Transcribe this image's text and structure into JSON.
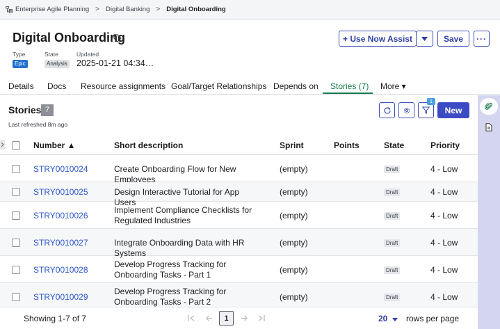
{
  "breadcrumb": {
    "items": [
      "Enterprise Agile Planning",
      "Digital Banking",
      "Digital Onboarding"
    ],
    "separator": ">"
  },
  "header": {
    "title": "Digital Onboarding",
    "type_label": "Type",
    "type_value": "Epic",
    "state_label": "State",
    "state_value": "Analysis",
    "updated_label": "Updated",
    "updated_value": "2025-01-21 04:34…",
    "assist_label": "+ Use Now Assist",
    "save_label": "Save",
    "more_label": "···"
  },
  "tabs": [
    {
      "label": "Details"
    },
    {
      "label": "Docs"
    },
    {
      "label": "Resource assignments"
    },
    {
      "label": "Goal/Target Relationships"
    },
    {
      "label": "Depends on"
    },
    {
      "label": "Stories (7)"
    },
    {
      "label": "More ▾"
    }
  ],
  "active_tab": "Stories (7)",
  "stories": {
    "title": "Stories",
    "count": "7",
    "last_refreshed": "Last refreshed 8m ago",
    "filter_count": "1",
    "new_label": "New",
    "columns": [
      "Number ▲",
      "Short description",
      "Sprint",
      "Points",
      "State",
      "Priority"
    ],
    "rows": [
      {
        "number": "STRY0010024",
        "description": "Create Onboarding Flow for New Employees",
        "sprint": "(empty)",
        "points": "",
        "state": "Draft",
        "priority": "4 - Low"
      },
      {
        "number": "STRY0010025",
        "description": "Design Interactive Tutorial for App Users",
        "sprint": "(empty)",
        "points": "",
        "state": "Draft",
        "priority": "4 - Low"
      },
      {
        "number": "STRY0010026",
        "description": "Implement Compliance Checklists for Regulated Industries",
        "sprint": "(empty)",
        "points": "",
        "state": "Draft",
        "priority": "4 - Low"
      },
      {
        "number": "STRY0010027",
        "description": "Integrate Onboarding Data with HR Systems",
        "sprint": "(empty)",
        "points": "",
        "state": "Draft",
        "priority": "4 - Low"
      },
      {
        "number": "STRY0010028",
        "description": "Develop Progress Tracking for Onboarding Tasks - Part 1",
        "sprint": "(empty)",
        "points": "",
        "state": "Draft",
        "priority": "4 - Low"
      },
      {
        "number": "STRY0010029",
        "description": "Develop Progress Tracking for Onboarding Tasks - Part 2",
        "sprint": "(empty)",
        "points": "",
        "state": "Draft",
        "priority": "4 - Low"
      }
    ]
  },
  "footer": {
    "showing": "Showing 1-7 of 7",
    "current_page": "1",
    "per_page": "20",
    "per_page_label": "rows per page"
  },
  "colors": {
    "accent": "#3c4bc4",
    "link": "#2d57c9",
    "active_tab": "#127a4d",
    "epic_badge": "#1f6fd1",
    "rail": "#d4d6f0"
  }
}
